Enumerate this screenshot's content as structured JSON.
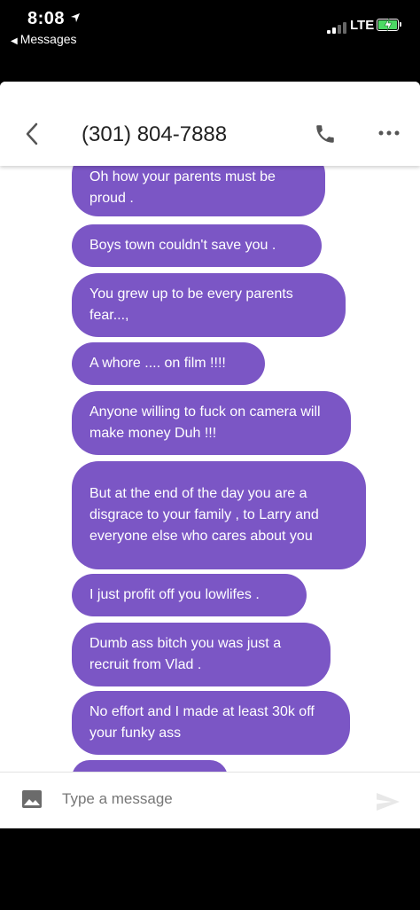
{
  "status_bar": {
    "time": "8:08",
    "back_app": "Messages",
    "network": "LTE"
  },
  "header": {
    "contact": "(301) 804-7888",
    "icons": {
      "back": "chevron-left-icon",
      "call": "phone-icon",
      "more": "more-horizontal-icon"
    }
  },
  "messages": [
    {
      "text": "Oh how your parents must be proud ."
    },
    {
      "text": "Boys town couldn't save you ."
    },
    {
      "text": "You grew up to be every parents fear...,"
    },
    {
      "text": "A whore .... on film !!!!"
    },
    {
      "text": "Anyone willing to fuck on camera will make money Duh !!!"
    },
    {
      "text": "But at the end of the day you are a disgrace to your family , to Larry and everyone else who cares about you"
    },
    {
      "text": "I just profit off you lowlifes ."
    },
    {
      "text": "Dumb ass bitch you was just a recruit from Vlad ."
    },
    {
      "text": "No effort and I made at least 30k off your funky ass"
    },
    {
      "text": ""
    }
  ],
  "compose": {
    "placeholder": "Type a message",
    "icons": {
      "attach": "image-icon",
      "send": "send-icon"
    }
  },
  "colors": {
    "bubble": "#7b56c5",
    "bubble_text": "#ffffff",
    "battery": "#4cd964"
  }
}
